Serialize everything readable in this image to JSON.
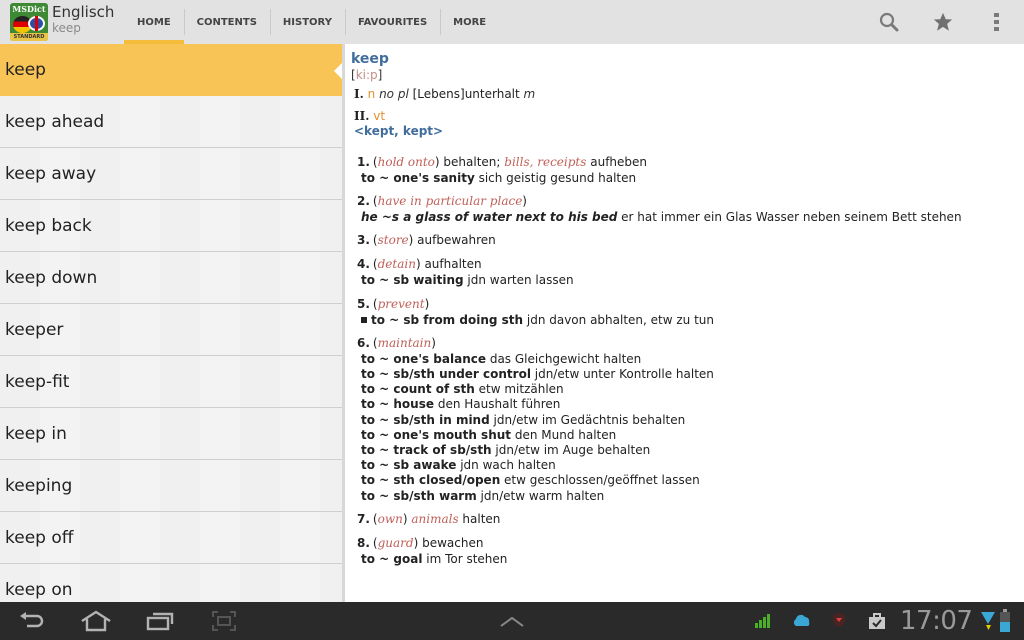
{
  "app": {
    "icon": {
      "brand": "MSDict",
      "edition": "STANDARD"
    },
    "title": "Englisch",
    "subtitle": "keep"
  },
  "tabs": [
    {
      "label": "HOME",
      "active": true
    },
    {
      "label": "CONTENTS",
      "active": false
    },
    {
      "label": "HISTORY",
      "active": false
    },
    {
      "label": "FAVOURITES",
      "active": false
    },
    {
      "label": "MORE",
      "active": false
    }
  ],
  "actions": [
    {
      "icon": "search-icon"
    },
    {
      "icon": "star-icon"
    },
    {
      "icon": "overflow-menu-icon"
    }
  ],
  "colors": {
    "accent": "#f5bd3c",
    "headword": "#416d9c",
    "pos": "#e0912f",
    "gloss": "#c0605a"
  },
  "wordlist": {
    "selected_index": 0,
    "items": [
      "keep",
      "keep ahead",
      "keep away",
      "keep back",
      "keep down",
      "keeper",
      "keep-fit",
      "keep in",
      "keeping",
      "keep off",
      "keep on"
    ]
  },
  "article": {
    "headword": "keep",
    "pron_open": "[",
    "pron": "ki:p",
    "pron_close": "]",
    "part1": {
      "roman": "I.",
      "pos": "n",
      "gram": "no pl",
      "text": "[Lebens]unterhalt",
      "gender": "m"
    },
    "part2": {
      "roman": "II.",
      "pos": "vt",
      "forms": "<kept, kept>"
    },
    "senses": [
      {
        "num": "1.",
        "open": "(",
        "gloss": "hold onto",
        "close": ")",
        "text": " behalten; ",
        "gloss2": "bills, receipts",
        "text2": " aufheben",
        "examples": [
          {
            "en": "to ~ one's sanity",
            "de": " sich geistig gesund halten"
          }
        ]
      },
      {
        "num": "2.",
        "open": "(",
        "gloss": "have in particular place",
        "close": ")",
        "examples": [
          {
            "en": "he ~s a glass of water next to his bed",
            "de": " er hat immer ein Glas Wasser neben seinem Bett stehen",
            "italic": true
          }
        ]
      },
      {
        "num": "3.",
        "open": "(",
        "gloss": "store",
        "close": ")",
        "text": " aufbewahren",
        "examples": []
      },
      {
        "num": "4.",
        "open": "(",
        "gloss": "detain",
        "close": ")",
        "text": " aufhalten",
        "examples": [
          {
            "en": "to ~ sb waiting",
            "de": " jdn warten lassen"
          }
        ]
      },
      {
        "num": "5.",
        "open": "(",
        "gloss": "prevent",
        "close": ")",
        "examples": [
          {
            "en": "to ~ sb from doing sth",
            "de": " jdn davon abhalten, etw zu tun",
            "bullet": true
          }
        ]
      },
      {
        "num": "6.",
        "open": "(",
        "gloss": "maintain",
        "close": ")",
        "examples": [
          {
            "en": "to ~ one's balance",
            "de": " das Gleichgewicht halten"
          },
          {
            "en": "to ~ sb/sth under control",
            "de": " jdn/etw unter Kontrolle halten"
          },
          {
            "en": "to ~ count of sth",
            "de": " etw mitzählen"
          },
          {
            "en": "to ~ house",
            "de": " den Haushalt führen"
          },
          {
            "en": "to ~ sb/sth in mind",
            "de": " jdn/etw im Gedächtnis behalten"
          },
          {
            "en": "to ~ one's mouth shut",
            "de": " den Mund halten"
          },
          {
            "en": "to ~ track of sb/sth",
            "de": " jdn/etw im Auge behalten"
          },
          {
            "en": "to ~ sb awake",
            "de": " jdn wach halten"
          },
          {
            "en": "to ~ sth closed/open",
            "de": " etw geschlossen/geöffnet lassen"
          },
          {
            "en": "to ~ sb/sth warm",
            "de": " jdn/etw warm halten"
          }
        ]
      },
      {
        "num": "7.",
        "open": "(",
        "gloss": "own",
        "close": ")",
        "text": " ",
        "gloss2": "animals",
        "text2": " halten",
        "examples": []
      },
      {
        "num": "8.",
        "open": "(",
        "gloss": "guard",
        "close": ")",
        "text": " bewachen",
        "examples": [
          {
            "en": "to ~ goal",
            "de": " im Tor stehen"
          }
        ]
      }
    ]
  },
  "systembar": {
    "nav": [
      {
        "icon": "back-icon"
      },
      {
        "icon": "home-icon"
      },
      {
        "icon": "recent-apps-icon"
      },
      {
        "icon": "screenshot-icon"
      }
    ],
    "center": {
      "icon": "chevron-up-icon"
    },
    "status_icons": [
      "signal-icon",
      "cloud-icon",
      "shield-icon",
      "briefcase-check-icon"
    ],
    "time": "17:07"
  }
}
